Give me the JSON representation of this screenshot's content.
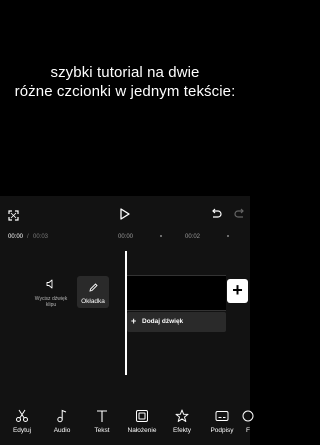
{
  "preview": {
    "caption_line1": "szybki tutorial na dwie",
    "caption_line2": "różne czcionki w jednym tekście:"
  },
  "timeline": {
    "current_time": "00:00",
    "separator": "/",
    "duration": "00:03",
    "ruler_ticks": [
      "00:00",
      "00:02"
    ],
    "mute_label": "Wycisz dźwięk klipu",
    "cover_label": "Okładka",
    "add_audio_label": "Dodaj dźwięk"
  },
  "toolbar": {
    "items": [
      {
        "label": "Edytuj",
        "icon": "scissors-icon"
      },
      {
        "label": "Audio",
        "icon": "music-note-icon"
      },
      {
        "label": "Tekst",
        "icon": "text-icon"
      },
      {
        "label": "Nałożenie",
        "icon": "overlay-icon"
      },
      {
        "label": "Efekty",
        "icon": "effects-icon"
      },
      {
        "label": "Podpisy",
        "icon": "captions-icon"
      },
      {
        "label": "F",
        "icon": "filter-icon"
      }
    ]
  },
  "colors": {
    "background": "#000000",
    "editor_background": "#121212",
    "text": "#ffffff",
    "muted_text": "#7a7a7a",
    "track": "#2a2a2a"
  }
}
